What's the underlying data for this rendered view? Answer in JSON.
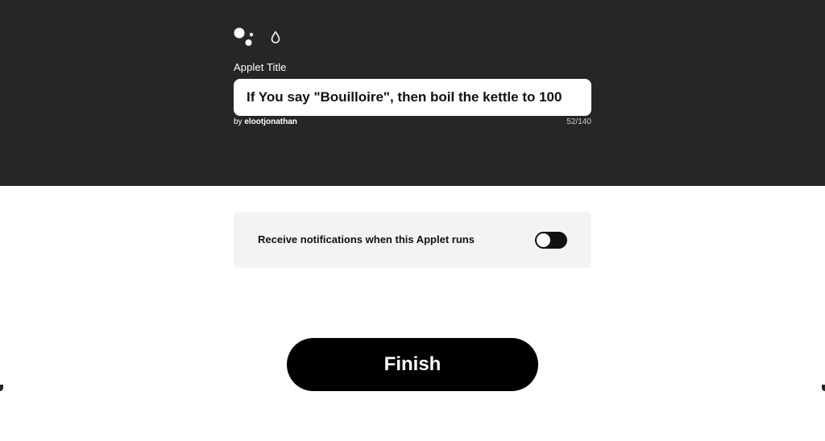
{
  "header": {
    "service_icons": [
      "google-assistant-icon",
      "water-drop-icon"
    ],
    "applet_title_label": "Applet Title",
    "applet_title_value": "If You say \"Bouilloire\", then boil the kettle to 100",
    "author_prefix": "by",
    "author_name": "elootjonathan",
    "char_count": "52/140"
  },
  "notifications": {
    "label": "Receive notifications when this Applet runs",
    "toggle_on": false
  },
  "actions": {
    "finish_label": "Finish"
  },
  "colors": {
    "header_bg": "#262626",
    "card_bg": "#f3f3f3",
    "button_bg": "#000000",
    "text_light": "#ffffff"
  }
}
